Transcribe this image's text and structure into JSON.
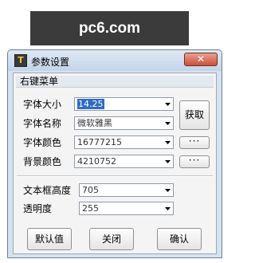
{
  "banner": {
    "text": "pc6.com"
  },
  "window": {
    "title": "参数设置",
    "app_icon_glyph": "T",
    "close_glyph": "✕"
  },
  "menu": {
    "label": "右键菜单"
  },
  "fields": [
    {
      "label": "字体大小",
      "value": "14.25",
      "selected": true
    },
    {
      "label": "字体名称",
      "value": "微软雅黑",
      "selected": false
    },
    {
      "label": "字体颜色",
      "value": "16777215",
      "selected": false
    },
    {
      "label": "背景颜色",
      "value": "4210752",
      "selected": false
    },
    {
      "label": "文本框高度",
      "value": "705",
      "selected": false
    },
    {
      "label": "透明度",
      "value": "255",
      "selected": false
    }
  ],
  "buttons": {
    "fetch": "获取",
    "color_pick_1": "···",
    "color_pick_2": "···",
    "default": "默认值",
    "close": "关闭",
    "confirm": "确认"
  },
  "colors": {
    "banner_bg": "#3b3b3b",
    "window_frame": "#d8e2ef",
    "close_button": "#c9513c",
    "selection": "#316ac5"
  },
  "icons": [
    "app-icon",
    "close-icon",
    "dropdown-arrow-icon"
  ]
}
